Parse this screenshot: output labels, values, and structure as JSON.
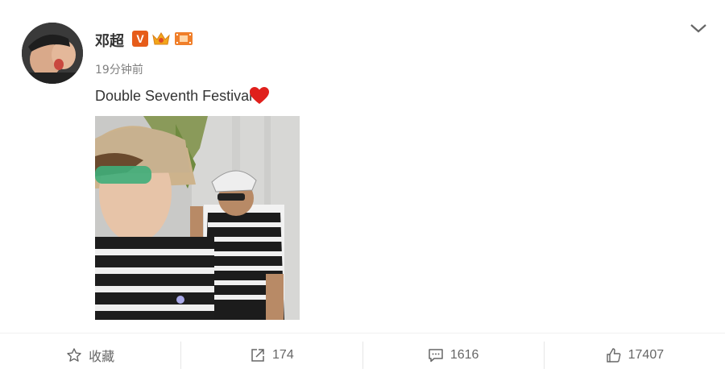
{
  "post": {
    "username": "邓超",
    "time": "19分钟前",
    "text": "Double Seventh Festival",
    "badges": {
      "verified_label": "V",
      "icons": [
        "crown-badge-icon",
        "film-badge-icon"
      ]
    },
    "emoji": "red-heart-icon"
  },
  "actions": {
    "favorite_label": "收藏",
    "repost_count": "174",
    "comment_count": "1616",
    "like_count": "17407"
  },
  "colors": {
    "verified": "#e65c1a",
    "heart": "#e0201c",
    "text": "#333333",
    "muted": "#808080"
  }
}
